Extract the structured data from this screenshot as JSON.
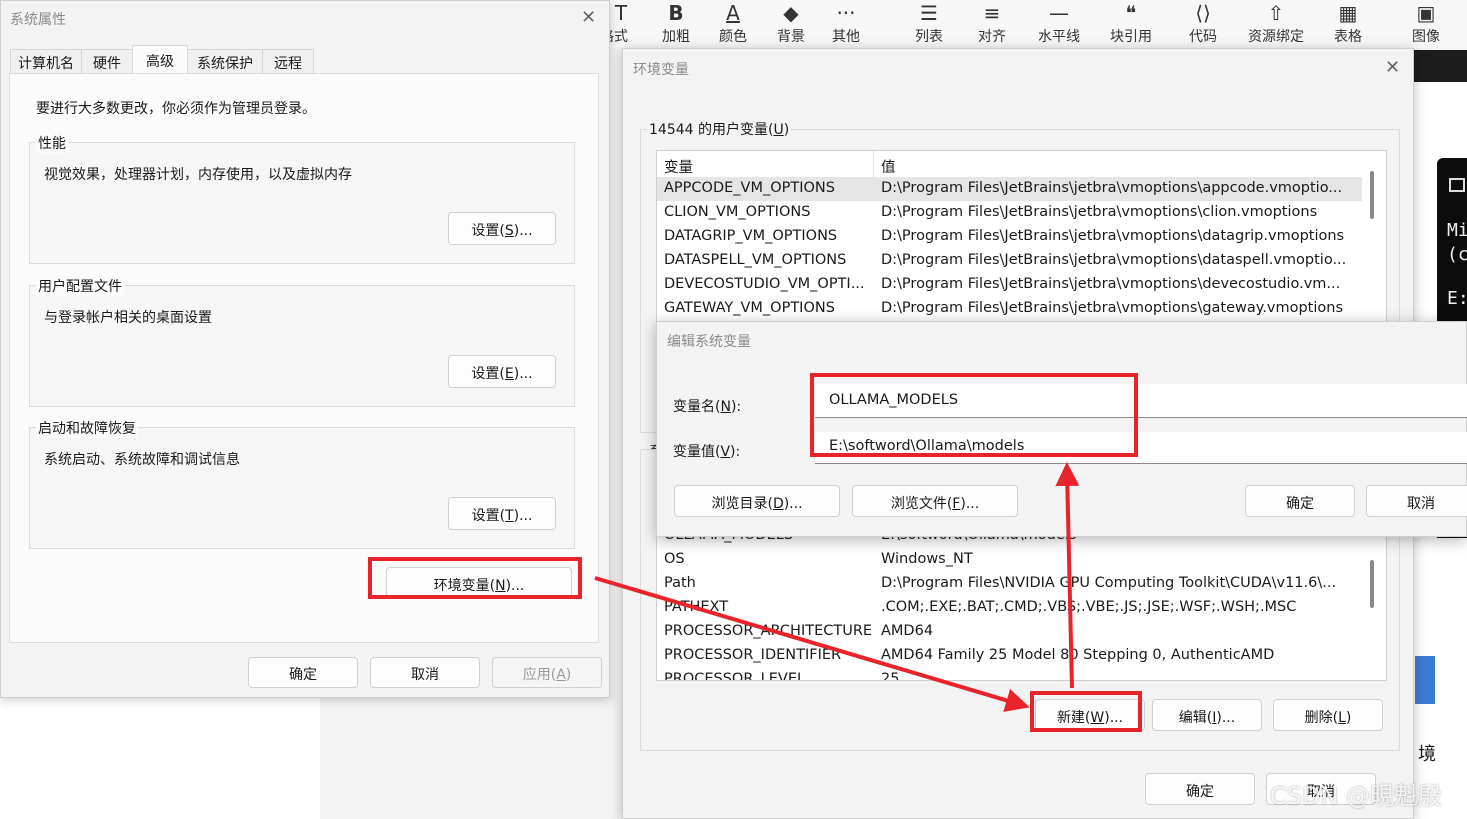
{
  "toolbar": {
    "items": [
      {
        "icon": "text-style-icon",
        "glyph": "T",
        "label": "格式"
      },
      {
        "icon": "bold-icon",
        "glyph": "B",
        "label": "加粗"
      },
      {
        "icon": "font-color-icon",
        "glyph": "A",
        "label": "颜色"
      },
      {
        "icon": "fill-color-icon",
        "glyph": "◆",
        "label": "背景"
      },
      {
        "icon": "more-icon",
        "glyph": "···",
        "label": "其他"
      },
      {
        "icon": "list-icon",
        "glyph": "☰",
        "label": "列表"
      },
      {
        "icon": "align-icon",
        "glyph": "≡",
        "label": "对齐"
      },
      {
        "icon": "horizontal-line-icon",
        "glyph": "—",
        "label": "水平线"
      },
      {
        "icon": "quote-icon",
        "glyph": "❝",
        "label": "块引用"
      },
      {
        "icon": "code-icon",
        "glyph": "⟨⟩",
        "label": "代码"
      },
      {
        "icon": "upload-icon",
        "glyph": "⇧",
        "label": "资源绑定"
      },
      {
        "icon": "table-icon",
        "glyph": "▦",
        "label": "表格"
      },
      {
        "icon": "image-icon",
        "glyph": "▣",
        "label": "图像"
      }
    ]
  },
  "sys_props": {
    "title": "系统属性",
    "tabs": [
      "计算机名",
      "硬件",
      "高级",
      "系统保护",
      "远程"
    ],
    "admin_note": "要进行大多数更改，你必须作为管理员登录。",
    "perf": {
      "legend": "性能",
      "desc": "视觉效果，处理器计划，内存使用，以及虚拟内存",
      "btn_pre": "设置(",
      "btn_key": "S",
      "btn_post": ")..."
    },
    "profile": {
      "legend": "用户配置文件",
      "desc": "与登录帐户相关的桌面设置",
      "btn_pre": "设置(",
      "btn_key": "E",
      "btn_post": ")..."
    },
    "startup": {
      "legend": "启动和故障恢复",
      "desc": "系统启动、系统故障和调试信息",
      "btn_pre": "设置(",
      "btn_key": "T",
      "btn_post": ")..."
    },
    "env_btn": {
      "pre": "环境变量(",
      "key": "N",
      "post": ")..."
    },
    "ok": "确定",
    "cancel": "取消",
    "apply_pre": "应用(",
    "apply_key": "A",
    "apply_post": ")"
  },
  "env_vars": {
    "title": "环境变量",
    "user_legend_pre": "14544 的用户变量(",
    "user_legend_key": "U",
    "user_legend_post": ")",
    "col_var": "变量",
    "col_val": "值",
    "user_rows": [
      {
        "var": "APPCODE_VM_OPTIONS",
        "val": "D:\\Program Files\\JetBrains\\jetbra\\vmoptions\\appcode.vmoptio..."
      },
      {
        "var": "CLION_VM_OPTIONS",
        "val": "D:\\Program Files\\JetBrains\\jetbra\\vmoptions\\clion.vmoptions"
      },
      {
        "var": "DATAGRIP_VM_OPTIONS",
        "val": "D:\\Program Files\\JetBrains\\jetbra\\vmoptions\\datagrip.vmoptions"
      },
      {
        "var": "DATASPELL_VM_OPTIONS",
        "val": "D:\\Program Files\\JetBrains\\jetbra\\vmoptions\\dataspell.vmoptio..."
      },
      {
        "var": "DEVECOSTUDIO_VM_OPTI...",
        "val": "D:\\Program Files\\JetBrains\\jetbra\\vmoptions\\devecostudio.vm..."
      },
      {
        "var": "GATEWAY_VM_OPTIONS",
        "val": "D:\\Program Files\\JetBrains\\jetbra\\vmoptions\\gateway.vmoptions"
      }
    ],
    "sys_legend_partial": "系",
    "sys_rows": [
      {
        "var": "OLLAMA_MODELS",
        "val": "E:\\softword\\Ollama\\models"
      },
      {
        "var": "OS",
        "val": "Windows_NT"
      },
      {
        "var": "Path",
        "val": "D:\\Program Files\\NVIDIA GPU Computing Toolkit\\CUDA\\v11.6\\..."
      },
      {
        "var": "PATHEXT",
        "val": ".COM;.EXE;.BAT;.CMD;.VBS;.VBE;.JS;.JSE;.WSF;.WSH;.MSC"
      },
      {
        "var": "PROCESSOR_ARCHITECTURE",
        "val": "AMD64"
      },
      {
        "var": "PROCESSOR_IDENTIFIER",
        "val": "AMD64 Family 25 Model 80 Stepping 0, AuthenticAMD"
      },
      {
        "var": "PROCESSOR_LEVEL",
        "val": "25"
      }
    ],
    "new_pre": "新建(",
    "new_key": "W",
    "new_post": ")...",
    "edit_pre": "编辑(",
    "edit_key": "I",
    "edit_post": ")...",
    "del_pre": "删除(",
    "del_key": "L",
    "del_post": ")",
    "ok": "确定",
    "cancel": "取消"
  },
  "edit_dialog": {
    "title": "编辑系统变量",
    "name_label_pre": "变量名(",
    "name_label_key": "N",
    "name_label_post": "):",
    "name_value": "OLLAMA_MODELS",
    "value_label_pre": "变量值(",
    "value_label_key": "V",
    "value_label_post": "):",
    "value_value": "E:\\softword\\Ollama\\models",
    "browse_dir_pre": "浏览目录(",
    "browse_dir_key": "D",
    "browse_dir_post": ")...",
    "browse_file_pre": "浏览文件(",
    "browse_file_key": "F",
    "browse_file_post": ")...",
    "ok": "确定",
    "cancel": "取消"
  },
  "terminal": {
    "lines": [
      "Mi",
      "(c",
      "E:"
    ]
  },
  "side_text": "境",
  "watermark": "CSDN @晛魁殷",
  "colors": {
    "annotation_red": "#e8232b",
    "dialog_bg": "#f3f3f3",
    "selected_row": "#e5e5e5"
  }
}
